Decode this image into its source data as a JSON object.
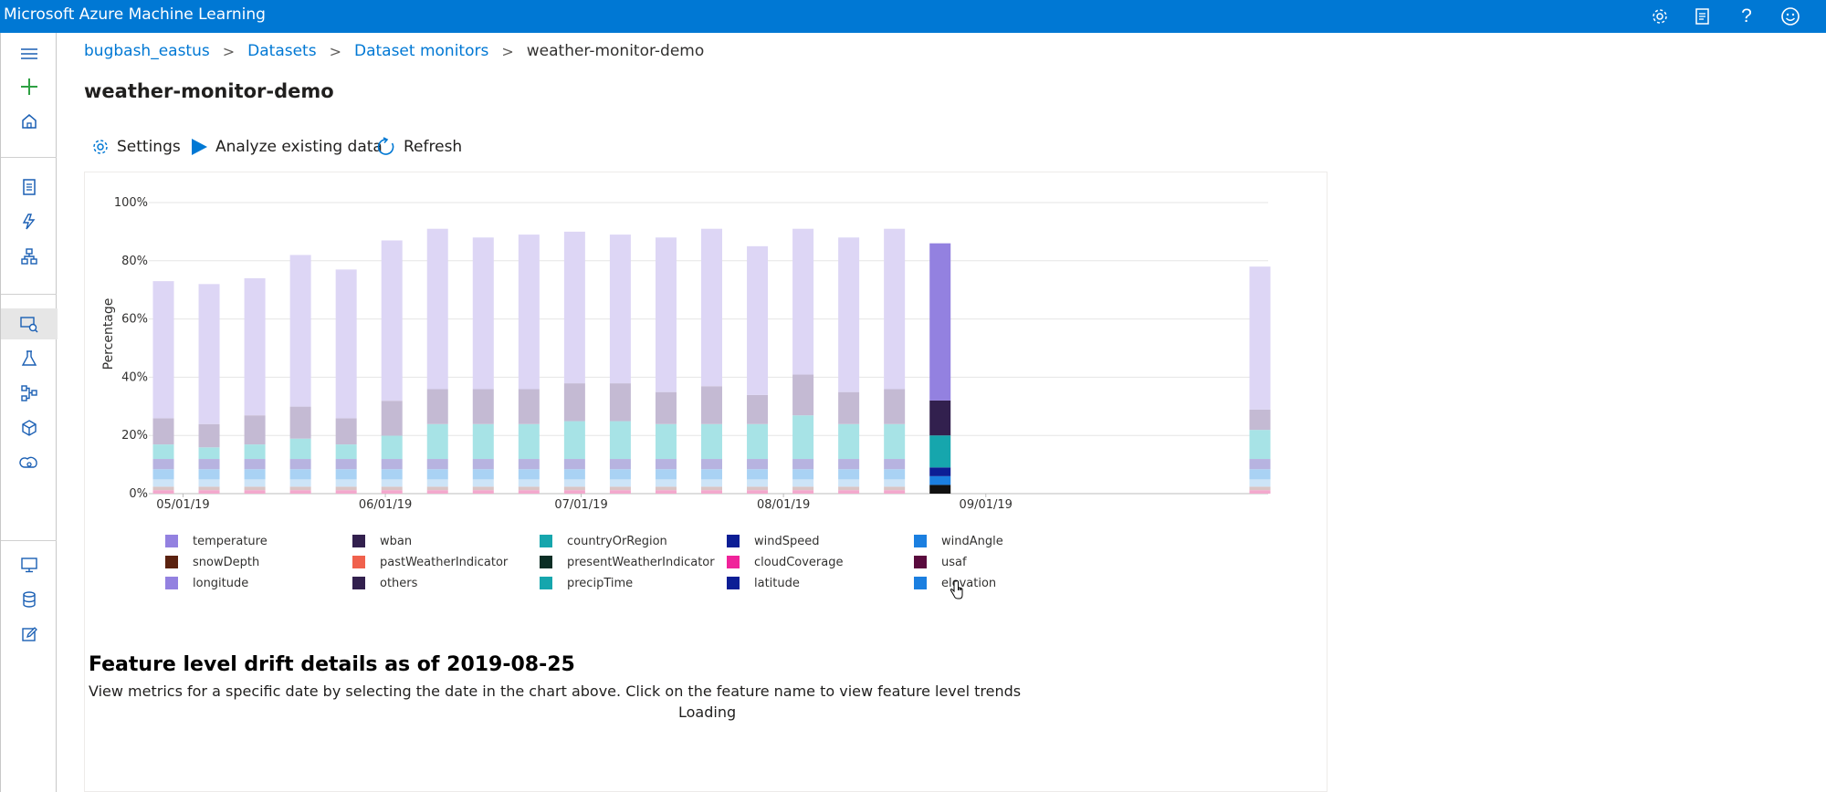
{
  "app": {
    "title": "Microsoft Azure Machine Learning"
  },
  "topbar_icons": [
    "gear-icon",
    "feedback-list-icon",
    "help-icon",
    "smiley-icon"
  ],
  "leftnav_icons": [
    "hamburger-menu-icon",
    "plus-icon",
    "home-icon",
    "notebook-icon",
    "automl-icon",
    "designer-icon",
    "datasets-icon",
    "experiments-icon",
    "pipelines-icon",
    "models-icon",
    "endpoints-icon",
    "compute-icon",
    "datastores-icon",
    "data-labeling-icon"
  ],
  "breadcrumb": {
    "items": [
      {
        "label": "bugbash_eastus"
      },
      {
        "label": "Datasets"
      },
      {
        "label": "Dataset monitors"
      },
      {
        "label": "weather-monitor-demo"
      }
    ],
    "separator": ">"
  },
  "page": {
    "title": "weather-monitor-demo"
  },
  "commands": {
    "settings": "Settings",
    "analyze": "Analyze existing data",
    "refresh": "Refresh"
  },
  "colors": {
    "accent": "#0078d4",
    "faded_top": "#ddd6f5",
    "faded_mid": "#c4bad3",
    "faded_cyan": "#a7e3e6"
  },
  "chart_data": {
    "type": "bar",
    "stacked": true,
    "ylabel": "Percentage",
    "ylim": [
      0,
      100
    ],
    "yticks": [
      "0%",
      "20%",
      "40%",
      "60%",
      "80%",
      "100%"
    ],
    "xticks": [
      "05/01/19",
      "06/01/19",
      "07/01/19",
      "08/01/19",
      "09/01/19"
    ],
    "x": [
      "2019-04-28",
      "2019-05-05",
      "2019-05-12",
      "2019-05-19",
      "2019-05-26",
      "2019-06-02",
      "2019-06-09",
      "2019-06-16",
      "2019-06-23",
      "2019-06-30",
      "2019-07-07",
      "2019-07-14",
      "2019-07-21",
      "2019-07-28",
      "2019-08-04",
      "2019-08-11",
      "2019-08-18",
      "2019-08-25",
      "2019-10-13"
    ],
    "totals": [
      73,
      72,
      74,
      82,
      77,
      87,
      91,
      88,
      89,
      90,
      89,
      88,
      91,
      85,
      91,
      88,
      91,
      86,
      78
    ],
    "selected": "2019-08-25",
    "selected_segments": [
      {
        "name": "temperature",
        "value": 54
      },
      {
        "name": "wban",
        "value": 12
      },
      {
        "name": "countryOrRegion",
        "value": 11
      },
      {
        "name": "windSpeed",
        "value": 3
      },
      {
        "name": "windAngle",
        "value": 3
      },
      {
        "name": "others",
        "value": 3
      }
    ],
    "legend": [
      {
        "name": "temperature",
        "color": "#9381e0"
      },
      {
        "name": "wban",
        "color": "#32204e"
      },
      {
        "name": "countryOrRegion",
        "color": "#16a6ad"
      },
      {
        "name": "windSpeed",
        "color": "#0c1e95"
      },
      {
        "name": "windAngle",
        "color": "#1b7fe0"
      },
      {
        "name": "snowDepth",
        "color": "#5b2210"
      },
      {
        "name": "pastWeatherIndicator",
        "color": "#f0614d"
      },
      {
        "name": "presentWeatherIndicator",
        "color": "#0b2e25"
      },
      {
        "name": "cloudCoverage",
        "color": "#f0239a"
      },
      {
        "name": "usaf",
        "color": "#5a0b3e"
      },
      {
        "name": "longitude",
        "color": "#9381e0"
      },
      {
        "name": "others",
        "color": "#32204e"
      },
      {
        "name": "precipTime",
        "color": "#16a6ad"
      },
      {
        "name": "latitude",
        "color": "#0c1e95"
      },
      {
        "name": "elevation",
        "color": "#1b7fe0"
      }
    ]
  },
  "drift": {
    "title": "Feature level drift details as of 2019-08-25",
    "description": "View metrics for a specific date by selecting the date in the chart above. Click on the feature name to view feature level trends",
    "loading": "Loading"
  }
}
